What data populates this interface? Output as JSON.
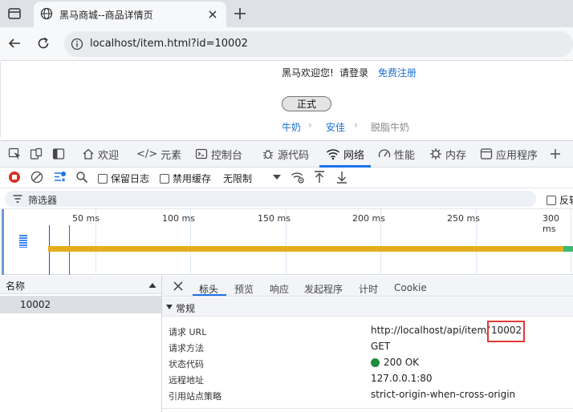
{
  "browser": {
    "tab_title": "黑马商城--商品详情页",
    "url": "localhost/item.html?id=10002"
  },
  "page": {
    "welcome": "黑马欢迎您!",
    "login": "请登录",
    "register": "免费注册",
    "button_label": "正式",
    "breadcrumb": [
      "牛奶",
      "安佳",
      "脱脂牛奶"
    ]
  },
  "devtools": {
    "tabs": [
      "欢迎",
      "元素",
      "控制台",
      "源代码",
      "网络",
      "性能",
      "内存",
      "应用程序"
    ],
    "active_tab": "网络",
    "toolbar": {
      "preserve_log": "保留日志",
      "disable_cache": "禁用缓存",
      "throttle": "无限制"
    },
    "filter_placeholder": "筛选器",
    "filter_right_label": "反转",
    "timeline_ticks": [
      "50 ms",
      "100 ms",
      "150 ms",
      "200 ms",
      "250 ms",
      "300 ms"
    ],
    "list_header": "名称",
    "requests": [
      {
        "name": "10002"
      }
    ],
    "detail_tabs": [
      "标头",
      "预览",
      "响应",
      "发起程序",
      "计时",
      "Cookie"
    ],
    "active_detail_tab": "标头",
    "general_section": "常规",
    "general": [
      {
        "key": "请求 URL",
        "value_prefix": "http://localhost/api/item/",
        "value_highlight": "10002"
      },
      {
        "key": "请求方法",
        "value": "GET"
      },
      {
        "key": "状态代码",
        "value": "200 OK"
      },
      {
        "key": "远程地址",
        "value": "127.0.0.1:80"
      },
      {
        "key": "引用站点策略",
        "value": "strict-origin-when-cross-origin"
      }
    ]
  },
  "colors": {
    "accent": "#1a73e8",
    "link": "#1a6fd4",
    "status_ok": "#1e8e3e",
    "highlight_box": "#e53935",
    "timeline_bar": "#e3ad1c"
  }
}
